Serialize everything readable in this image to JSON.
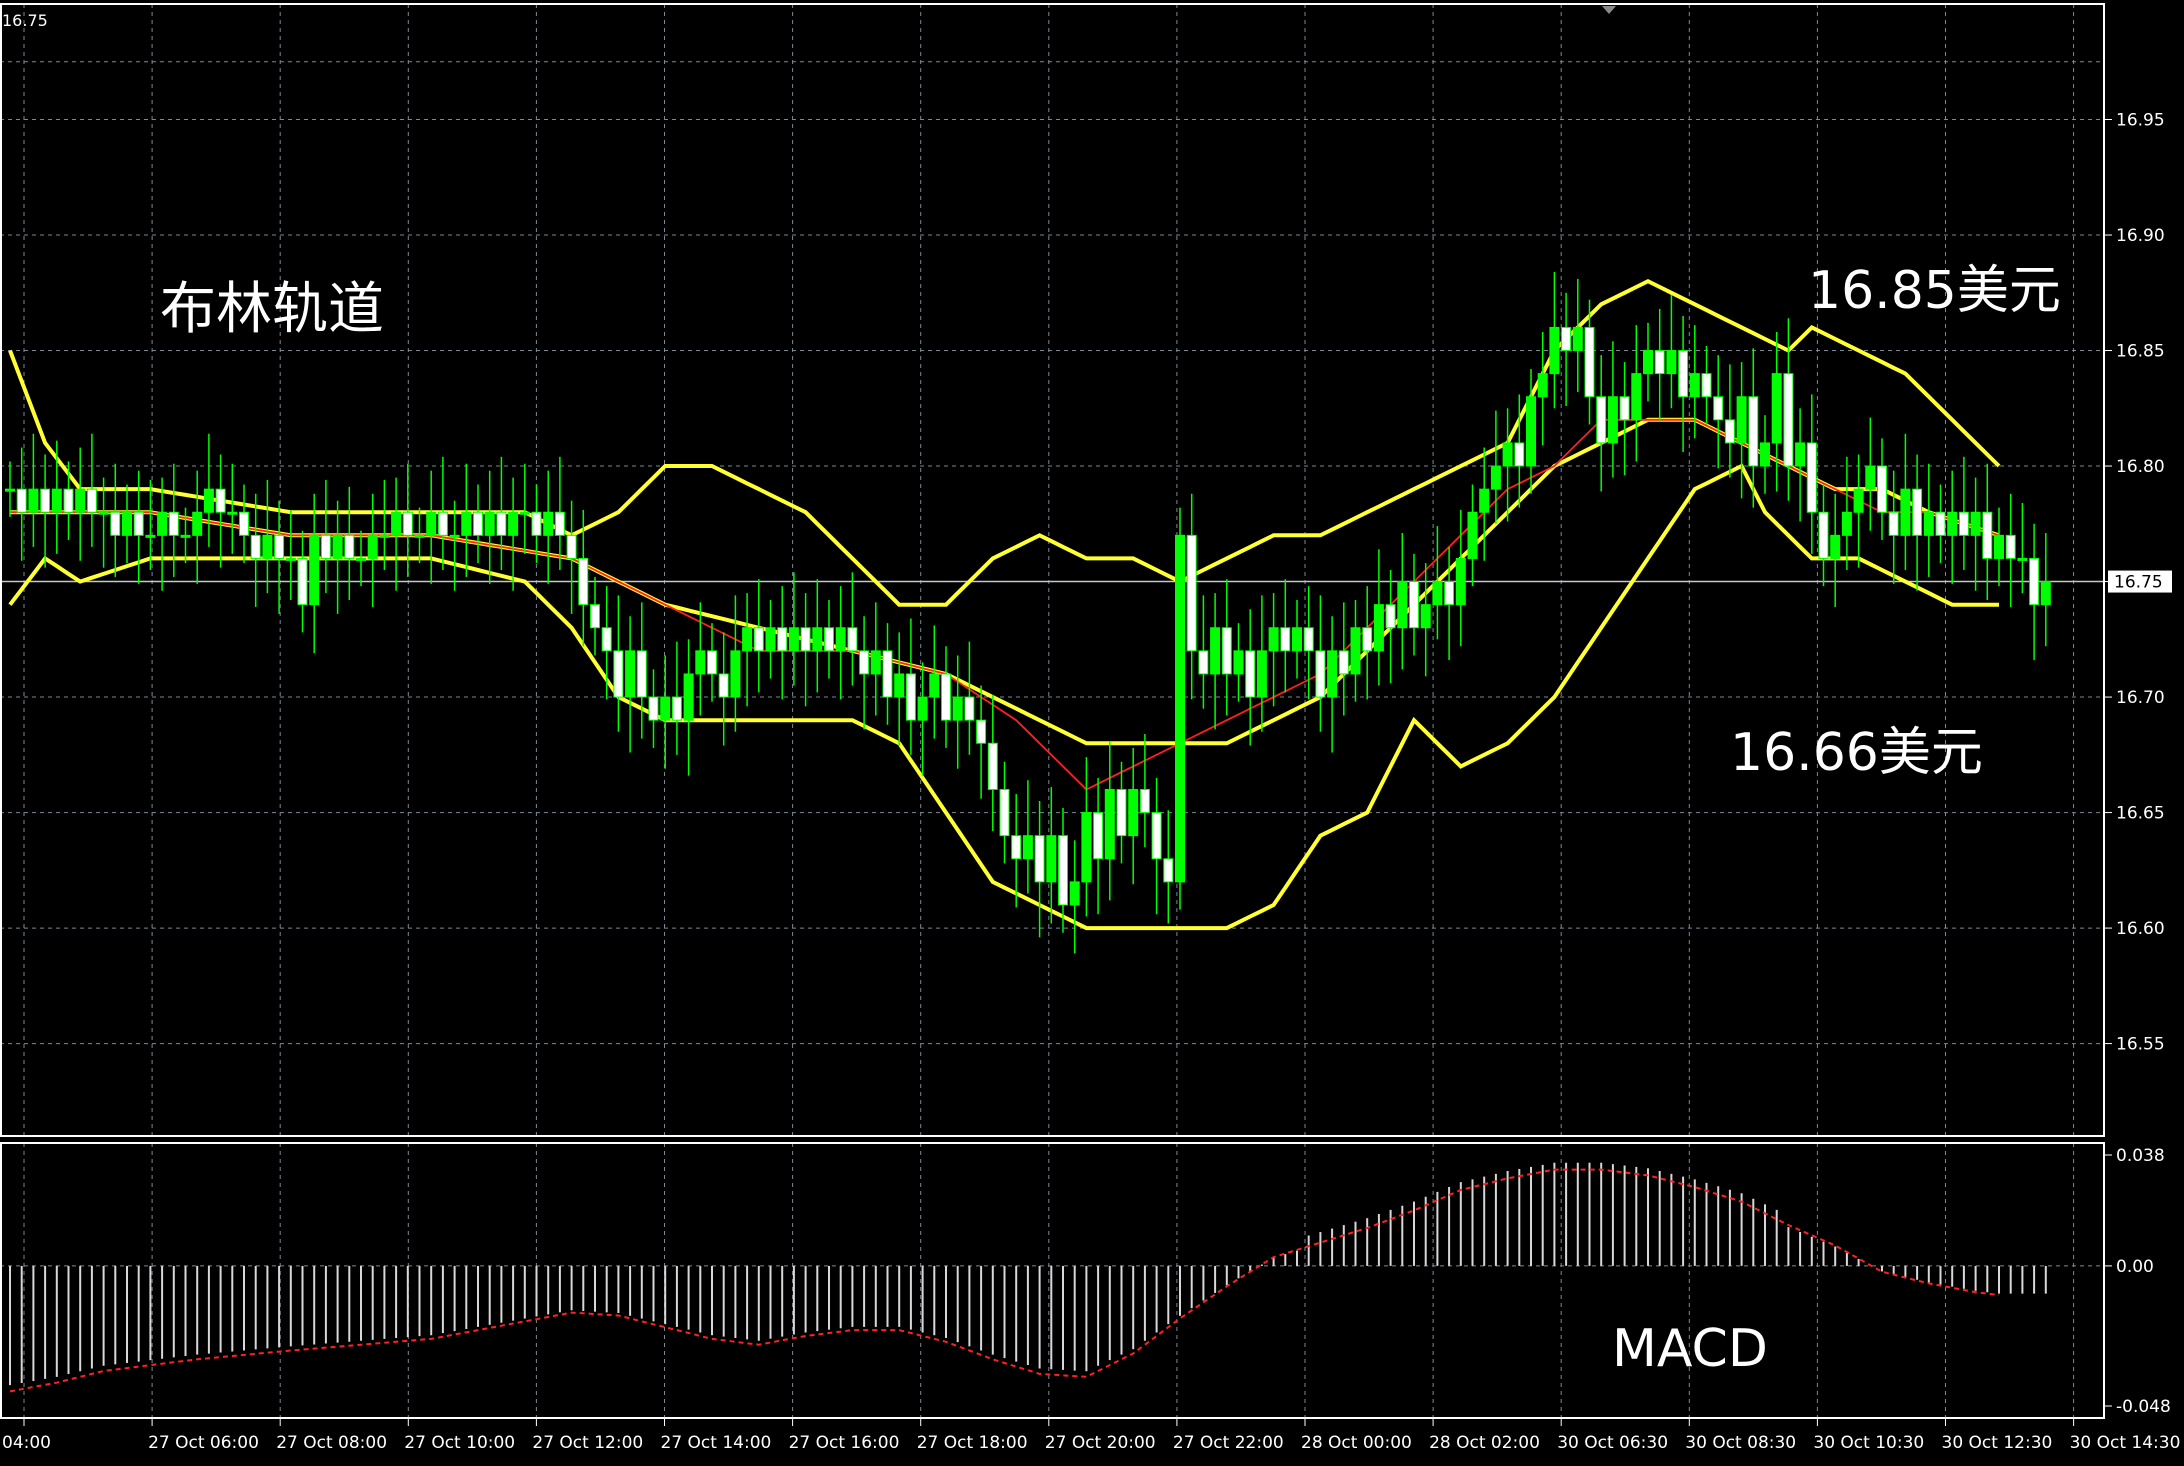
{
  "chart_data": {
    "type": "candlestick",
    "symbol_price_label": "16.75",
    "current_price": "16.75",
    "colors": {
      "background": "#000000",
      "grid": "#7a8a96",
      "candle_up": "#00ff00",
      "candle_down_body": "#ffffff",
      "bollinger": "#ffff33",
      "moving_average": "#ff2020",
      "macd_histogram": "#d8d8d8",
      "macd_signal": "#ff2020",
      "price_line": "#c0c8d0"
    },
    "price_axis": {
      "ylim": [
        16.51,
        17.0
      ],
      "ticks": [
        "16.95",
        "16.90",
        "16.85",
        "16.80",
        "16.75",
        "16.70",
        "16.65",
        "16.60",
        "16.55"
      ]
    },
    "macd_axis": {
      "ylim": [
        -0.048,
        0.038
      ],
      "ticks": [
        "0.038",
        "0.00",
        "-0.048"
      ]
    },
    "time_labels": [
      "04:00",
      "27 Oct 06:00",
      "27 Oct 08:00",
      "27 Oct 10:00",
      "27 Oct 12:00",
      "27 Oct 14:00",
      "27 Oct 16:00",
      "27 Oct 18:00",
      "27 Oct 20:00",
      "27 Oct 22:00",
      "28 Oct 00:00",
      "28 Oct 02:00",
      "30 Oct 06:30",
      "30 Oct 08:30",
      "30 Oct 10:30",
      "30 Oct 12:30",
      "30 Oct 14:30"
    ],
    "closes": [
      16.79,
      16.78,
      16.79,
      16.78,
      16.79,
      16.78,
      16.79,
      16.78,
      16.78,
      16.77,
      16.78,
      16.77,
      16.77,
      16.78,
      16.77,
      16.77,
      16.78,
      16.79,
      16.78,
      16.78,
      16.77,
      16.76,
      16.77,
      16.76,
      16.76,
      16.74,
      16.77,
      16.76,
      16.77,
      16.76,
      16.76,
      16.77,
      16.77,
      16.78,
      16.77,
      16.77,
      16.78,
      16.77,
      16.77,
      16.78,
      16.77,
      16.78,
      16.77,
      16.78,
      16.78,
      16.77,
      16.78,
      16.77,
      16.76,
      16.74,
      16.73,
      16.72,
      16.7,
      16.72,
      16.7,
      16.69,
      16.7,
      16.69,
      16.71,
      16.72,
      16.71,
      16.7,
      16.72,
      16.73,
      16.72,
      16.73,
      16.72,
      16.73,
      16.72,
      16.73,
      16.72,
      16.73,
      16.72,
      16.71,
      16.72,
      16.7,
      16.71,
      16.69,
      16.7,
      16.71,
      16.69,
      16.7,
      16.69,
      16.68,
      16.66,
      16.64,
      16.63,
      16.64,
      16.62,
      16.64,
      16.61,
      16.62,
      16.65,
      16.63,
      16.66,
      16.64,
      16.66,
      16.65,
      16.63,
      16.62,
      16.77,
      16.72,
      16.71,
      16.73,
      16.71,
      16.72,
      16.7,
      16.72,
      16.73,
      16.72,
      16.73,
      16.72,
      16.7,
      16.72,
      16.71,
      16.73,
      16.72,
      16.74,
      16.73,
      16.75,
      16.73,
      16.74,
      16.75,
      16.74,
      16.76,
      16.78,
      16.79,
      16.8,
      16.81,
      16.8,
      16.83,
      16.84,
      16.86,
      16.85,
      16.86,
      16.83,
      16.81,
      16.83,
      16.82,
      16.84,
      16.85,
      16.84,
      16.85,
      16.83,
      16.84,
      16.83,
      16.82,
      16.81,
      16.83,
      16.8,
      16.81,
      16.84,
      16.8,
      16.81,
      16.78,
      16.76,
      16.77,
      16.78,
      16.79,
      16.8,
      16.78,
      16.77,
      16.79,
      16.77,
      16.78,
      16.77,
      16.78,
      16.77,
      16.78,
      16.76,
      16.77,
      16.76,
      16.76,
      16.74,
      16.75
    ],
    "upper_band_points": [
      [
        0,
        16.85
      ],
      [
        3,
        16.81
      ],
      [
        6,
        16.79
      ],
      [
        12,
        16.79
      ],
      [
        24,
        16.78
      ],
      [
        36,
        16.78
      ],
      [
        44,
        16.78
      ],
      [
        48,
        16.77
      ],
      [
        52,
        16.78
      ],
      [
        56,
        16.8
      ],
      [
        60,
        16.8
      ],
      [
        64,
        16.79
      ],
      [
        68,
        16.78
      ],
      [
        72,
        16.76
      ],
      [
        76,
        16.74
      ],
      [
        80,
        16.74
      ],
      [
        84,
        16.76
      ],
      [
        88,
        16.77
      ],
      [
        92,
        16.76
      ],
      [
        96,
        16.76
      ],
      [
        100,
        16.75
      ],
      [
        104,
        16.76
      ],
      [
        108,
        16.77
      ],
      [
        112,
        16.77
      ],
      [
        116,
        16.78
      ],
      [
        120,
        16.79
      ],
      [
        124,
        16.8
      ],
      [
        128,
        16.81
      ],
      [
        132,
        16.85
      ],
      [
        136,
        16.87
      ],
      [
        140,
        16.88
      ],
      [
        144,
        16.87
      ],
      [
        148,
        16.86
      ],
      [
        152,
        16.85
      ],
      [
        154,
        16.86
      ],
      [
        158,
        16.85
      ],
      [
        162,
        16.84
      ],
      [
        166,
        16.82
      ],
      [
        170,
        16.8
      ]
    ],
    "middle_band_points": [
      [
        0,
        16.78
      ],
      [
        12,
        16.78
      ],
      [
        24,
        16.77
      ],
      [
        36,
        16.77
      ],
      [
        48,
        16.76
      ],
      [
        56,
        16.74
      ],
      [
        64,
        16.73
      ],
      [
        72,
        16.72
      ],
      [
        80,
        16.71
      ],
      [
        88,
        16.69
      ],
      [
        92,
        16.68
      ],
      [
        96,
        16.68
      ],
      [
        100,
        16.68
      ],
      [
        104,
        16.68
      ],
      [
        108,
        16.69
      ],
      [
        112,
        16.7
      ],
      [
        116,
        16.72
      ],
      [
        120,
        16.74
      ],
      [
        124,
        16.76
      ],
      [
        128,
        16.78
      ],
      [
        132,
        16.8
      ],
      [
        136,
        16.81
      ],
      [
        140,
        16.82
      ],
      [
        144,
        16.82
      ],
      [
        148,
        16.81
      ],
      [
        152,
        16.8
      ],
      [
        156,
        16.79
      ],
      [
        160,
        16.79
      ],
      [
        164,
        16.78
      ],
      [
        170,
        16.77
      ]
    ],
    "lower_band_points": [
      [
        0,
        16.74
      ],
      [
        3,
        16.76
      ],
      [
        6,
        16.75
      ],
      [
        12,
        16.76
      ],
      [
        24,
        16.76
      ],
      [
        36,
        16.76
      ],
      [
        44,
        16.75
      ],
      [
        48,
        16.73
      ],
      [
        52,
        16.7
      ],
      [
        56,
        16.69
      ],
      [
        60,
        16.69
      ],
      [
        64,
        16.69
      ],
      [
        68,
        16.69
      ],
      [
        72,
        16.69
      ],
      [
        76,
        16.68
      ],
      [
        80,
        16.65
      ],
      [
        84,
        16.62
      ],
      [
        88,
        16.61
      ],
      [
        92,
        16.6
      ],
      [
        96,
        16.6
      ],
      [
        100,
        16.6
      ],
      [
        104,
        16.6
      ],
      [
        108,
        16.61
      ],
      [
        112,
        16.64
      ],
      [
        116,
        16.65
      ],
      [
        120,
        16.69
      ],
      [
        124,
        16.67
      ],
      [
        128,
        16.68
      ],
      [
        132,
        16.7
      ],
      [
        136,
        16.73
      ],
      [
        140,
        16.76
      ],
      [
        144,
        16.79
      ],
      [
        148,
        16.8
      ],
      [
        150,
        16.78
      ],
      [
        154,
        16.76
      ],
      [
        158,
        16.76
      ],
      [
        162,
        16.75
      ],
      [
        166,
        16.74
      ],
      [
        170,
        16.74
      ]
    ],
    "moving_average_points": [
      [
        0,
        16.78
      ],
      [
        12,
        16.78
      ],
      [
        24,
        16.77
      ],
      [
        36,
        16.77
      ],
      [
        48,
        16.76
      ],
      [
        56,
        16.74
      ],
      [
        64,
        16.72
      ],
      [
        72,
        16.72
      ],
      [
        80,
        16.71
      ],
      [
        86,
        16.69
      ],
      [
        92,
        16.66
      ],
      [
        96,
        16.67
      ],
      [
        100,
        16.68
      ],
      [
        104,
        16.69
      ],
      [
        108,
        16.7
      ],
      [
        112,
        16.71
      ],
      [
        116,
        16.73
      ],
      [
        120,
        16.75
      ],
      [
        124,
        16.77
      ],
      [
        128,
        16.79
      ],
      [
        132,
        16.8
      ],
      [
        136,
        16.82
      ],
      [
        140,
        16.82
      ],
      [
        144,
        16.82
      ],
      [
        148,
        16.81
      ],
      [
        152,
        16.8
      ],
      [
        156,
        16.79
      ],
      [
        160,
        16.78
      ],
      [
        164,
        16.78
      ],
      [
        170,
        16.77
      ]
    ],
    "macd_signal_points": [
      [
        0,
        -0.043
      ],
      [
        4,
        -0.04
      ],
      [
        8,
        -0.036
      ],
      [
        16,
        -0.032
      ],
      [
        24,
        -0.029
      ],
      [
        36,
        -0.025
      ],
      [
        44,
        -0.019
      ],
      [
        48,
        -0.016
      ],
      [
        52,
        -0.017
      ],
      [
        56,
        -0.021
      ],
      [
        60,
        -0.025
      ],
      [
        64,
        -0.027
      ],
      [
        68,
        -0.024
      ],
      [
        72,
        -0.022
      ],
      [
        76,
        -0.022
      ],
      [
        80,
        -0.026
      ],
      [
        84,
        -0.032
      ],
      [
        88,
        -0.037
      ],
      [
        92,
        -0.038
      ],
      [
        96,
        -0.03
      ],
      [
        100,
        -0.018
      ],
      [
        104,
        -0.007
      ],
      [
        108,
        0.003
      ],
      [
        112,
        0.008
      ],
      [
        116,
        0.013
      ],
      [
        120,
        0.019
      ],
      [
        124,
        0.026
      ],
      [
        128,
        0.03
      ],
      [
        132,
        0.033
      ],
      [
        136,
        0.033
      ],
      [
        140,
        0.031
      ],
      [
        144,
        0.027
      ],
      [
        148,
        0.022
      ],
      [
        152,
        0.014
      ],
      [
        156,
        0.007
      ],
      [
        160,
        -0.002
      ],
      [
        164,
        -0.006
      ],
      [
        168,
        -0.009
      ],
      [
        170,
        -0.01
      ]
    ],
    "annotations": {
      "title": "布林轨道",
      "upper_label": "16.85美元",
      "lower_label": "16.66美元",
      "macd_label": "MACD"
    }
  }
}
